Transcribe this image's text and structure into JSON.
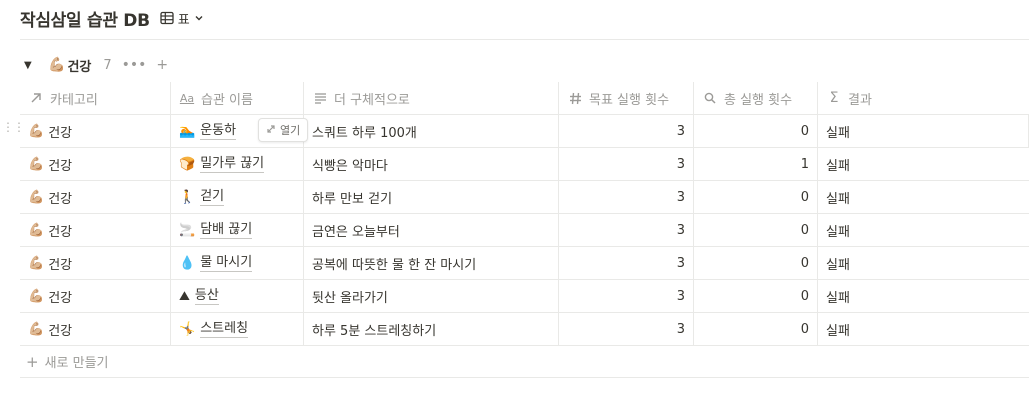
{
  "page": {
    "title": "작심삼일 습관 DB",
    "view_label": "표"
  },
  "group": {
    "label": "건강",
    "emoji": "💪🏼",
    "count": "7",
    "more": "•••",
    "add": "+"
  },
  "columns": [
    {
      "label": "카테고리",
      "icon": "relation-arrow-icon"
    },
    {
      "label": "습관 이름",
      "icon": "title-aa-icon"
    },
    {
      "label": "더 구체적으로",
      "icon": "text-lines-icon"
    },
    {
      "label": "목표 실행 횟수",
      "icon": "number-hash-icon"
    },
    {
      "label": "총 실행 횟수",
      "icon": "search-icon"
    },
    {
      "label": "결과",
      "icon": "sigma-icon"
    }
  ],
  "rows": [
    {
      "category": "건강",
      "cat_emoji": "💪🏼",
      "emoji": "🏊",
      "name": "운동하",
      "detail": "스쿼트 하루 100개",
      "goal": "3",
      "total": "0",
      "result": "실패"
    },
    {
      "category": "건강",
      "cat_emoji": "💪🏼",
      "emoji": "🍞",
      "name": "밀가루 끊기",
      "detail": "식빵은 악마다",
      "goal": "3",
      "total": "1",
      "result": "실패"
    },
    {
      "category": "건강",
      "cat_emoji": "💪🏼",
      "emoji": "🚶",
      "name": "걷기",
      "detail": "하루 만보 걷기",
      "goal": "3",
      "total": "0",
      "result": "실패"
    },
    {
      "category": "건강",
      "cat_emoji": "💪🏼",
      "emoji": "🚬",
      "name": "담배 끊기",
      "detail": "금연은 오늘부터",
      "goal": "3",
      "total": "0",
      "result": "실패"
    },
    {
      "category": "건강",
      "cat_emoji": "💪🏼",
      "emoji": "💧",
      "name": "물 마시기",
      "detail": "공복에 따뜻한 물 한 잔 마시기",
      "goal": "3",
      "total": "0",
      "result": "실패"
    },
    {
      "category": "건강",
      "cat_emoji": "💪🏼",
      "emoji": "⛰",
      "name": "등산",
      "detail": "뒷산 올라가기",
      "goal": "3",
      "total": "0",
      "result": "실패"
    },
    {
      "category": "건강",
      "cat_emoji": "💪🏼",
      "emoji": "🤸",
      "name": "스트레칭",
      "detail": "하루 5분 스트레칭하기",
      "goal": "3",
      "total": "0",
      "result": "실패"
    }
  ],
  "hover": {
    "open_label": "열기"
  },
  "footer": {
    "new_label": "새로 만들기"
  },
  "colors": {
    "text": "#37352f",
    "muted": "#9b9a97",
    "border": "#e9e9e7"
  }
}
